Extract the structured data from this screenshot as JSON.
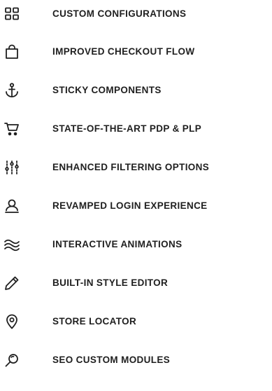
{
  "features": {
    "color": "#1f1f1f",
    "items": [
      {
        "label": "CUSTOM CONFIGURATIONS",
        "icon": "grid-icon"
      },
      {
        "label": "IMPROVED CHECKOUT FLOW",
        "icon": "shopping-bag-icon"
      },
      {
        "label": "STICKY COMPONENTS",
        "icon": "anchor-icon"
      },
      {
        "label": "STATE-OF-THE-ART PDP & PLP",
        "icon": "shopping-cart-icon"
      },
      {
        "label": "ENHANCED FILTERING OPTIONS",
        "icon": "sliders-icon"
      },
      {
        "label": "REVAMPED LOGIN EXPERIENCE",
        "icon": "user-icon"
      },
      {
        "label": "INTERACTIVE ANIMATIONS",
        "icon": "waves-icon"
      },
      {
        "label": "BUILT-IN STYLE EDITOR",
        "icon": "pencil-icon"
      },
      {
        "label": "STORE LOCATOR",
        "icon": "map-pin-icon"
      },
      {
        "label": "SEO CUSTOM MODULES",
        "icon": "search-icon"
      }
    ]
  }
}
